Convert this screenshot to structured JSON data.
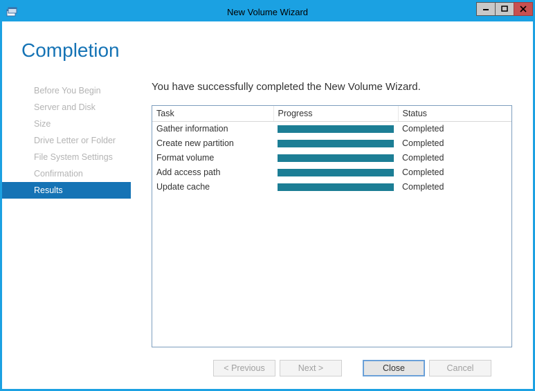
{
  "window": {
    "title": "New Volume Wizard"
  },
  "heading": "Completion",
  "sidebar": {
    "items": [
      {
        "label": "Before You Begin",
        "active": false
      },
      {
        "label": "Server and Disk",
        "active": false
      },
      {
        "label": "Size",
        "active": false
      },
      {
        "label": "Drive Letter or Folder",
        "active": false
      },
      {
        "label": "File System Settings",
        "active": false
      },
      {
        "label": "Confirmation",
        "active": false
      },
      {
        "label": "Results",
        "active": true
      }
    ]
  },
  "main": {
    "success_message": "You have successfully completed the New Volume Wizard.",
    "columns": {
      "task": "Task",
      "progress": "Progress",
      "status": "Status"
    },
    "tasks": [
      {
        "task": "Gather information",
        "progress": 100,
        "status": "Completed"
      },
      {
        "task": "Create new partition",
        "progress": 100,
        "status": "Completed"
      },
      {
        "task": "Format volume",
        "progress": 100,
        "status": "Completed"
      },
      {
        "task": "Add access path",
        "progress": 100,
        "status": "Completed"
      },
      {
        "task": "Update cache",
        "progress": 100,
        "status": "Completed"
      }
    ]
  },
  "footer": {
    "previous": "< Previous",
    "next": "Next >",
    "close": "Close",
    "cancel": "Cancel"
  }
}
